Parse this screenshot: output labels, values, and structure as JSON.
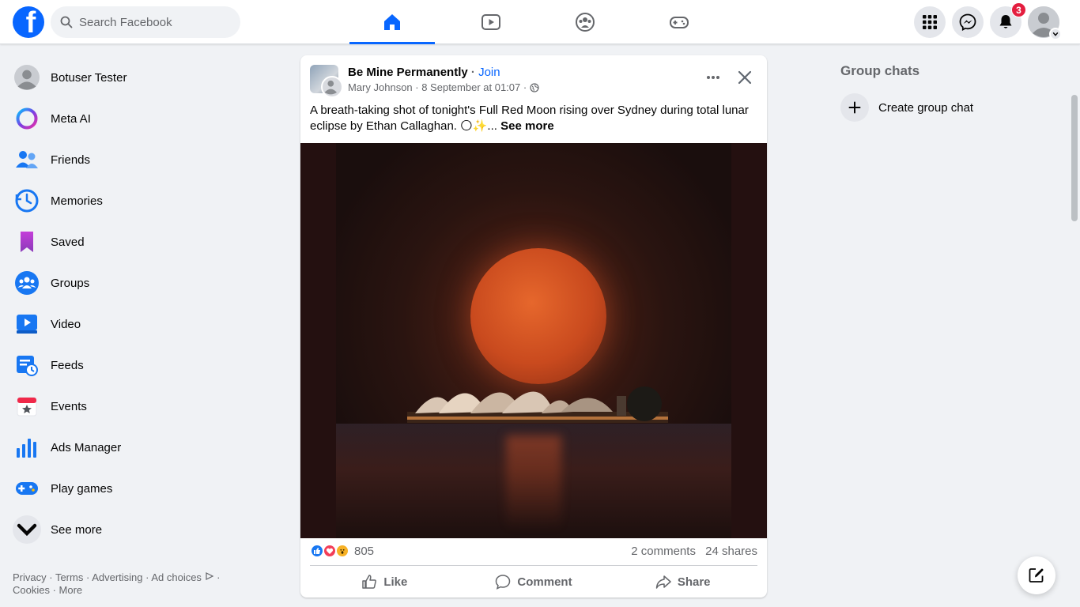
{
  "topbar": {
    "logo": "f",
    "search_placeholder": "Search Facebook",
    "notifications_count": "3",
    "tabs": [
      "home-icon",
      "video-icon",
      "groups-icon",
      "gaming-icon"
    ]
  },
  "sidebar": {
    "items": [
      {
        "label": "Botuser Tester",
        "icon": "profile-avatar"
      },
      {
        "label": "Meta AI",
        "icon": "meta-ai-icon"
      },
      {
        "label": "Friends",
        "icon": "friends-icon"
      },
      {
        "label": "Memories",
        "icon": "memories-icon"
      },
      {
        "label": "Saved",
        "icon": "saved-icon"
      },
      {
        "label": "Groups",
        "icon": "groups-icon"
      },
      {
        "label": "Video",
        "icon": "video-icon"
      },
      {
        "label": "Feeds",
        "icon": "feeds-icon"
      },
      {
        "label": "Events",
        "icon": "events-icon"
      },
      {
        "label": "Ads Manager",
        "icon": "ads-manager-icon"
      },
      {
        "label": "Play games",
        "icon": "play-games-icon"
      },
      {
        "label": "See more",
        "icon": "chevron-down-icon"
      }
    ]
  },
  "footer": {
    "privacy": "Privacy",
    "terms": "Terms",
    "advertising": "Advertising",
    "ad_choices": "Ad choices",
    "cookies": "Cookies",
    "more": "More"
  },
  "post": {
    "group_name": "Be Mine Permanently",
    "join": "Join",
    "author": "Mary Johnson",
    "date": "8 September at 01:07",
    "text": "A breath-taking shot of tonight's Full Red Moon rising over Sydney during total lunar eclipse by Ethan Callaghan. 🌕✨...",
    "see_more": "See more",
    "reactions_count": "805",
    "comments": "2 comments",
    "shares": "24 shares",
    "like": "Like",
    "comment": "Comment",
    "share": "Share"
  },
  "rightcol": {
    "title": "Group chats",
    "create_label": "Create group chat"
  },
  "colors": {
    "brand": "#0866ff",
    "badge": "#e41e3f"
  }
}
